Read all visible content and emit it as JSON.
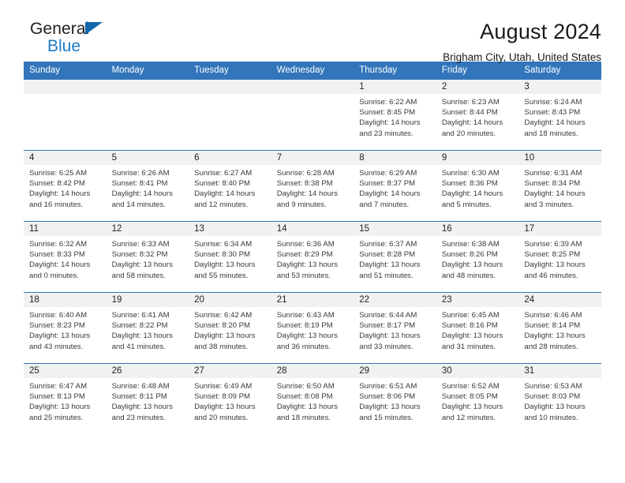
{
  "logo": {
    "line1": "General",
    "line2": "Blue",
    "icon": "triangle-icon"
  },
  "header": {
    "month_title": "August 2024",
    "location": "Brigham City, Utah, United States"
  },
  "colors": {
    "header_blue": "#3275bb",
    "logo_blue": "#1e7bc4",
    "daynum_bg": "#f1f1f1"
  },
  "calendar": {
    "weekday_headers": [
      "Sunday",
      "Monday",
      "Tuesday",
      "Wednesday",
      "Thursday",
      "Friday",
      "Saturday"
    ],
    "labels": {
      "sunrise": "Sunrise:",
      "sunset": "Sunset:",
      "daylight": "Daylight:"
    },
    "weeks": [
      [
        {
          "day": ""
        },
        {
          "day": ""
        },
        {
          "day": ""
        },
        {
          "day": ""
        },
        {
          "day": "1",
          "sunrise": "Sunrise: 6:22 AM",
          "sunset": "Sunset: 8:45 PM",
          "daylight": "Daylight: 14 hours and 23 minutes."
        },
        {
          "day": "2",
          "sunrise": "Sunrise: 6:23 AM",
          "sunset": "Sunset: 8:44 PM",
          "daylight": "Daylight: 14 hours and 20 minutes."
        },
        {
          "day": "3",
          "sunrise": "Sunrise: 6:24 AM",
          "sunset": "Sunset: 8:43 PM",
          "daylight": "Daylight: 14 hours and 18 minutes."
        }
      ],
      [
        {
          "day": "4",
          "sunrise": "Sunrise: 6:25 AM",
          "sunset": "Sunset: 8:42 PM",
          "daylight": "Daylight: 14 hours and 16 minutes."
        },
        {
          "day": "5",
          "sunrise": "Sunrise: 6:26 AM",
          "sunset": "Sunset: 8:41 PM",
          "daylight": "Daylight: 14 hours and 14 minutes."
        },
        {
          "day": "6",
          "sunrise": "Sunrise: 6:27 AM",
          "sunset": "Sunset: 8:40 PM",
          "daylight": "Daylight: 14 hours and 12 minutes."
        },
        {
          "day": "7",
          "sunrise": "Sunrise: 6:28 AM",
          "sunset": "Sunset: 8:38 PM",
          "daylight": "Daylight: 14 hours and 9 minutes."
        },
        {
          "day": "8",
          "sunrise": "Sunrise: 6:29 AM",
          "sunset": "Sunset: 8:37 PM",
          "daylight": "Daylight: 14 hours and 7 minutes."
        },
        {
          "day": "9",
          "sunrise": "Sunrise: 6:30 AM",
          "sunset": "Sunset: 8:36 PM",
          "daylight": "Daylight: 14 hours and 5 minutes."
        },
        {
          "day": "10",
          "sunrise": "Sunrise: 6:31 AM",
          "sunset": "Sunset: 8:34 PM",
          "daylight": "Daylight: 14 hours and 3 minutes."
        }
      ],
      [
        {
          "day": "11",
          "sunrise": "Sunrise: 6:32 AM",
          "sunset": "Sunset: 8:33 PM",
          "daylight": "Daylight: 14 hours and 0 minutes."
        },
        {
          "day": "12",
          "sunrise": "Sunrise: 6:33 AM",
          "sunset": "Sunset: 8:32 PM",
          "daylight": "Daylight: 13 hours and 58 minutes."
        },
        {
          "day": "13",
          "sunrise": "Sunrise: 6:34 AM",
          "sunset": "Sunset: 8:30 PM",
          "daylight": "Daylight: 13 hours and 55 minutes."
        },
        {
          "day": "14",
          "sunrise": "Sunrise: 6:36 AM",
          "sunset": "Sunset: 8:29 PM",
          "daylight": "Daylight: 13 hours and 53 minutes."
        },
        {
          "day": "15",
          "sunrise": "Sunrise: 6:37 AM",
          "sunset": "Sunset: 8:28 PM",
          "daylight": "Daylight: 13 hours and 51 minutes."
        },
        {
          "day": "16",
          "sunrise": "Sunrise: 6:38 AM",
          "sunset": "Sunset: 8:26 PM",
          "daylight": "Daylight: 13 hours and 48 minutes."
        },
        {
          "day": "17",
          "sunrise": "Sunrise: 6:39 AM",
          "sunset": "Sunset: 8:25 PM",
          "daylight": "Daylight: 13 hours and 46 minutes."
        }
      ],
      [
        {
          "day": "18",
          "sunrise": "Sunrise: 6:40 AM",
          "sunset": "Sunset: 8:23 PM",
          "daylight": "Daylight: 13 hours and 43 minutes."
        },
        {
          "day": "19",
          "sunrise": "Sunrise: 6:41 AM",
          "sunset": "Sunset: 8:22 PM",
          "daylight": "Daylight: 13 hours and 41 minutes."
        },
        {
          "day": "20",
          "sunrise": "Sunrise: 6:42 AM",
          "sunset": "Sunset: 8:20 PM",
          "daylight": "Daylight: 13 hours and 38 minutes."
        },
        {
          "day": "21",
          "sunrise": "Sunrise: 6:43 AM",
          "sunset": "Sunset: 8:19 PM",
          "daylight": "Daylight: 13 hours and 36 minutes."
        },
        {
          "day": "22",
          "sunrise": "Sunrise: 6:44 AM",
          "sunset": "Sunset: 8:17 PM",
          "daylight": "Daylight: 13 hours and 33 minutes."
        },
        {
          "day": "23",
          "sunrise": "Sunrise: 6:45 AM",
          "sunset": "Sunset: 8:16 PM",
          "daylight": "Daylight: 13 hours and 31 minutes."
        },
        {
          "day": "24",
          "sunrise": "Sunrise: 6:46 AM",
          "sunset": "Sunset: 8:14 PM",
          "daylight": "Daylight: 13 hours and 28 minutes."
        }
      ],
      [
        {
          "day": "25",
          "sunrise": "Sunrise: 6:47 AM",
          "sunset": "Sunset: 8:13 PM",
          "daylight": "Daylight: 13 hours and 25 minutes."
        },
        {
          "day": "26",
          "sunrise": "Sunrise: 6:48 AM",
          "sunset": "Sunset: 8:11 PM",
          "daylight": "Daylight: 13 hours and 23 minutes."
        },
        {
          "day": "27",
          "sunrise": "Sunrise: 6:49 AM",
          "sunset": "Sunset: 8:09 PM",
          "daylight": "Daylight: 13 hours and 20 minutes."
        },
        {
          "day": "28",
          "sunrise": "Sunrise: 6:50 AM",
          "sunset": "Sunset: 8:08 PM",
          "daylight": "Daylight: 13 hours and 18 minutes."
        },
        {
          "day": "29",
          "sunrise": "Sunrise: 6:51 AM",
          "sunset": "Sunset: 8:06 PM",
          "daylight": "Daylight: 13 hours and 15 minutes."
        },
        {
          "day": "30",
          "sunrise": "Sunrise: 6:52 AM",
          "sunset": "Sunset: 8:05 PM",
          "daylight": "Daylight: 13 hours and 12 minutes."
        },
        {
          "day": "31",
          "sunrise": "Sunrise: 6:53 AM",
          "sunset": "Sunset: 8:03 PM",
          "daylight": "Daylight: 13 hours and 10 minutes."
        }
      ]
    ]
  }
}
